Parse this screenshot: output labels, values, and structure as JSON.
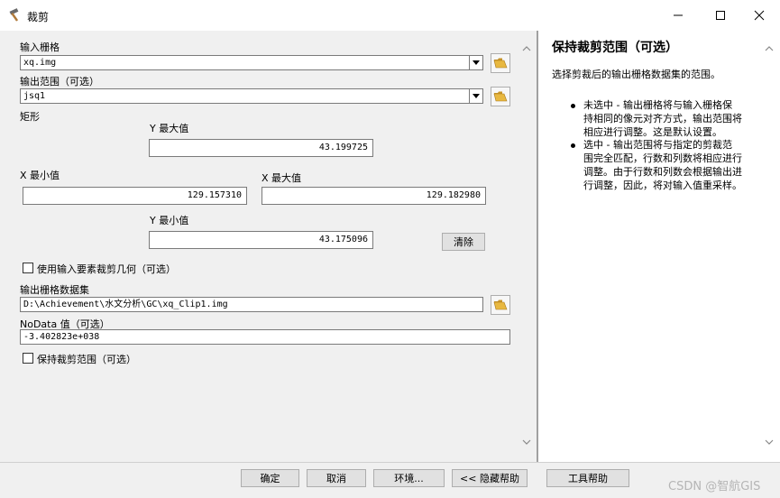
{
  "window": {
    "title": "裁剪",
    "minimize_icon": "minimize-icon",
    "maximize_icon": "maximize-icon",
    "close_icon": "close-icon"
  },
  "form": {
    "input_raster": {
      "label": "输入栅格",
      "value": "xq.img"
    },
    "output_extent": {
      "label": "输出范围（可选）",
      "value": "jsq1"
    },
    "rectangle": {
      "label": "矩形",
      "y_max": {
        "label": "Y 最大值",
        "value": "43.199725"
      },
      "x_min": {
        "label": "X 最小值",
        "value": "129.157310"
      },
      "x_max": {
        "label": "X 最大值",
        "value": "129.182980"
      },
      "y_min": {
        "label": "Y 最小值",
        "value": "43.175096"
      },
      "clear_label": "清除"
    },
    "use_input_features": {
      "label": "使用输入要素裁剪几何（可选）",
      "checked": false
    },
    "output_raster": {
      "label": "输出栅格数据集",
      "value": "D:\\Achievement\\水文分析\\GC\\xq_Clip1.img"
    },
    "nodata": {
      "label": "NoData 值（可选）",
      "value": "-3.402823e+038"
    },
    "maintain_extent": {
      "label": "保持裁剪范围（可选）",
      "checked": false
    }
  },
  "help": {
    "title": "保持裁剪范围（可选）",
    "description": "选择剪裁后的输出栅格数据集的范围。",
    "bullets": [
      [
        "未选中 - 输出栅格将与输入栅格保",
        "持相同的像元对齐方式，输出范围将",
        "相应进行调整。这是默认设置。"
      ],
      [
        "选中 - 输出范围将与指定的剪裁范",
        "围完全匹配，行数和列数将相应进行",
        "调整。由于行数和列数会根据输出进",
        "行调整，因此，将对输入值重采样。"
      ]
    ]
  },
  "buttons": {
    "ok": "确定",
    "cancel": "取消",
    "environments": "环境...",
    "hide_help": "<< 隐藏帮助",
    "tool_help": "工具帮助"
  },
  "watermark": "CSDN @智航GIS",
  "colors": {
    "folder": "#e8b840",
    "window_bg": "#f0f0f0",
    "divider": "#a0a0a0"
  }
}
